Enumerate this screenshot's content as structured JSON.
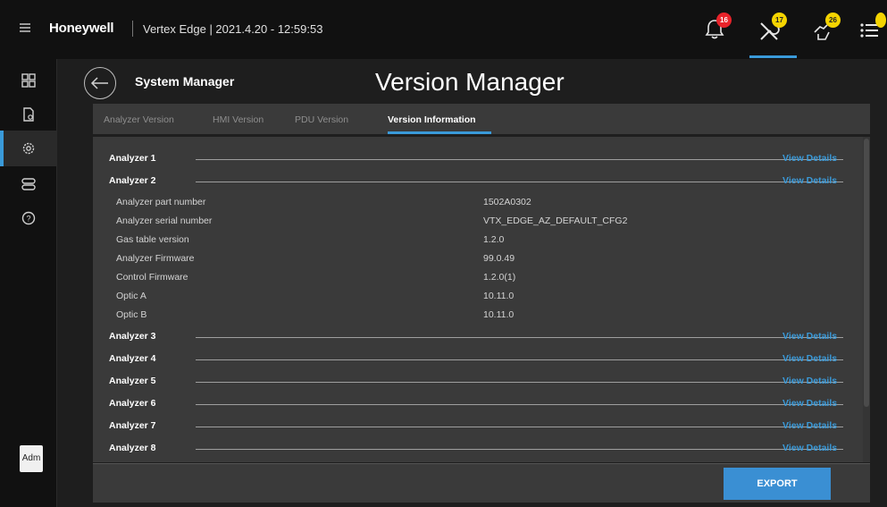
{
  "app": {
    "brand": "Honeywell",
    "title": "Vertex Edge | 2021.4.20 - 12:59:53"
  },
  "topbar": {
    "icons": [
      {
        "name": "bell-icon",
        "badge": "16",
        "badge_color": "#e8232a"
      },
      {
        "name": "wrench-screwdriver-icon",
        "badge": "17",
        "badge_color": "#f5d400"
      },
      {
        "name": "hand-icon",
        "badge": "26",
        "badge_color": "#f5d400"
      },
      {
        "name": "event-list-icon",
        "badge": "",
        "badge_color": "#f5d400"
      }
    ]
  },
  "sidebar": {
    "items": [
      {
        "name": "dashboard-grid-icon",
        "active": false
      },
      {
        "name": "document-icon",
        "active": false
      },
      {
        "name": "gear-icon",
        "active": true
      },
      {
        "name": "toggle-icon",
        "active": false
      },
      {
        "name": "help-icon",
        "active": false
      }
    ],
    "user_label": "Adm"
  },
  "header": {
    "section": "System Manager",
    "title": "Version Manager"
  },
  "tabs": [
    {
      "label": "Analyzer Version",
      "active": false
    },
    {
      "label": "HMI Version",
      "active": false
    },
    {
      "label": "PDU Version",
      "active": false
    },
    {
      "label": "Version Information",
      "active": true
    }
  ],
  "analyzers": [
    {
      "label": "Analyzer 1",
      "link": "View Details"
    },
    {
      "label": "Analyzer 2",
      "link": "View Details"
    },
    {
      "label": "Analyzer 3",
      "link": "View Details"
    },
    {
      "label": "Analyzer 4",
      "link": "View Details"
    },
    {
      "label": "Analyzer 5",
      "link": "View Details"
    },
    {
      "label": "Analyzer 6",
      "link": "View Details"
    },
    {
      "label": "Analyzer 7",
      "link": "View Details"
    },
    {
      "label": "Analyzer 8",
      "link": "View Details"
    }
  ],
  "analyzer2_details": [
    {
      "key": "Analyzer part number",
      "value": "1502A0302"
    },
    {
      "key": "Analyzer serial number",
      "value": "VTX_EDGE_AZ_DEFAULT_CFG2"
    },
    {
      "key": "Gas table version",
      "value": "1.2.0"
    },
    {
      "key": "Analyzer Firmware",
      "value": "99.0.49"
    },
    {
      "key": "Control Firmware",
      "value": "1.2.0(1)"
    },
    {
      "key": "Optic A",
      "value": "10.11.0"
    },
    {
      "key": "Optic B",
      "value": "10.11.0"
    }
  ],
  "footer": {
    "export_label": "EXPORT"
  },
  "colors": {
    "accent": "#3a9ad9",
    "link": "#3a9ad9",
    "button": "#3a8fd3"
  }
}
